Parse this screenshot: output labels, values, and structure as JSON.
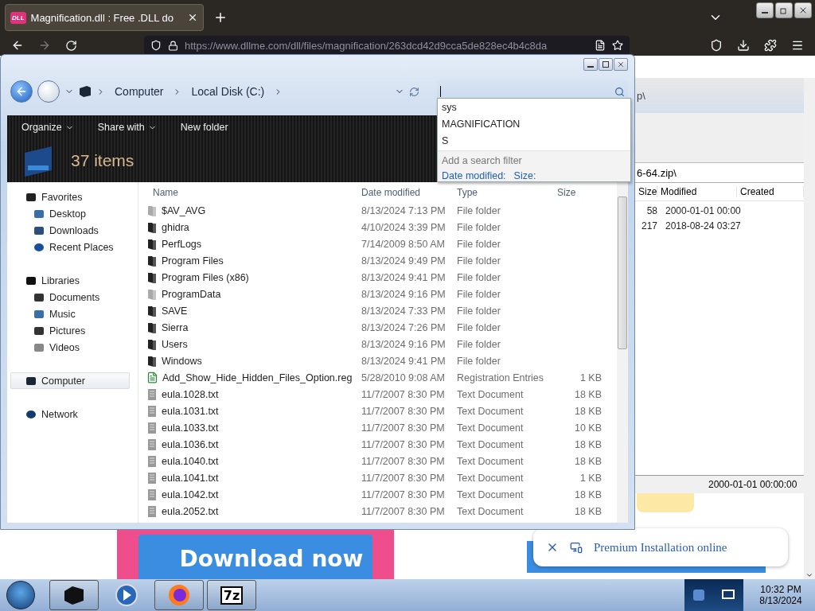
{
  "browser": {
    "tab": {
      "favicon": "DLL",
      "title": "Magnification.dll : Free .DLL do"
    },
    "url": "https://www.dllme.com/dll/files/magnification/263dcd42d9cca5de828ec4b4c8da"
  },
  "background_page": {
    "archive_window": {
      "title_fragment": "p\\",
      "path": "6-64.zip\\",
      "columns": [
        "Size",
        "Modified",
        "Created"
      ],
      "rows": [
        {
          "size": "58",
          "modified": "2000-01-01 00:00"
        },
        {
          "size": "217",
          "modified": "2018-08-24 03:27"
        }
      ],
      "status": "2000-01-01 00:00:00"
    },
    "download_button": "Download now",
    "notice": "Premium Installation online"
  },
  "explorer": {
    "breadcrumb": [
      "Computer",
      "Local Disk (C:)"
    ],
    "toolbar": [
      {
        "label": "Organize",
        "menu": true
      },
      {
        "label": "Share with",
        "menu": true
      },
      {
        "label": "New folder",
        "menu": false
      }
    ],
    "item_count": "37 items",
    "search": {
      "suggestions": [
        "sys",
        "MAGNIFICATION",
        "S"
      ],
      "filter_hint": "Add a search filter",
      "filters": [
        "Date modified:",
        "Size:"
      ]
    },
    "sidebar": [
      {
        "label": "Favorites",
        "kind": "star",
        "selected": false,
        "children": [
          {
            "label": "Desktop",
            "kind": "desktop",
            "selected": false
          },
          {
            "label": "Downloads",
            "kind": "downloads",
            "selected": false
          },
          {
            "label": "Recent Places",
            "kind": "recent",
            "selected": false
          }
        ]
      },
      {
        "label": "Libraries",
        "kind": "library",
        "selected": false,
        "children": [
          {
            "label": "Documents",
            "kind": "documents",
            "selected": false
          },
          {
            "label": "Music",
            "kind": "music",
            "selected": false
          },
          {
            "label": "Pictures",
            "kind": "pictures",
            "selected": false
          },
          {
            "label": "Videos",
            "kind": "videos",
            "selected": false
          }
        ]
      },
      {
        "label": "Computer",
        "kind": "computer",
        "selected": true
      },
      {
        "label": "Network",
        "kind": "network",
        "selected": false
      }
    ],
    "columns": [
      "Name",
      "Date modified",
      "Type",
      "Size"
    ],
    "rows": [
      {
        "kind": "hidden-folder",
        "name": "$AV_AVG",
        "date": "8/13/2024 7:13 PM",
        "type": "File folder"
      },
      {
        "kind": "folder",
        "name": "ghidra",
        "date": "4/10/2024 3:39 PM",
        "type": "File folder"
      },
      {
        "kind": "folder",
        "name": "PerfLogs",
        "date": "7/14/2009 8:50 AM",
        "type": "File folder"
      },
      {
        "kind": "folder",
        "name": "Program Files",
        "date": "8/13/2024 9:49 PM",
        "type": "File folder"
      },
      {
        "kind": "folder",
        "name": "Program Files (x86)",
        "date": "8/13/2024 9:41 PM",
        "type": "File folder"
      },
      {
        "kind": "hidden-folder",
        "name": "ProgramData",
        "date": "8/13/2024 9:16 PM",
        "type": "File folder"
      },
      {
        "kind": "folder",
        "name": "SAVE",
        "date": "8/13/2024 7:33 PM",
        "type": "File folder"
      },
      {
        "kind": "folder",
        "name": "Sierra",
        "date": "8/13/2024 7:26 PM",
        "type": "File folder"
      },
      {
        "kind": "folder",
        "name": "Users",
        "date": "8/13/2024 9:16 PM",
        "type": "File folder"
      },
      {
        "kind": "folder",
        "name": "Windows",
        "date": "8/13/2024 9:41 PM",
        "type": "File folder"
      },
      {
        "kind": "registry",
        "name": "Add_Show_Hide_Hidden_Files_Option.reg",
        "date": "5/28/2010 9:08 AM",
        "type": "Registration Entries",
        "size": "1 KB"
      },
      {
        "kind": "text",
        "name": "eula.1028.txt",
        "date": "11/7/2007 8:30 PM",
        "type": "Text Document",
        "size": "18 KB"
      },
      {
        "kind": "text",
        "name": "eula.1031.txt",
        "date": "11/7/2007 8:30 PM",
        "type": "Text Document",
        "size": "18 KB"
      },
      {
        "kind": "text",
        "name": "eula.1033.txt",
        "date": "11/7/2007 8:30 PM",
        "type": "Text Document",
        "size": "10 KB"
      },
      {
        "kind": "text",
        "name": "eula.1036.txt",
        "date": "11/7/2007 8:30 PM",
        "type": "Text Document",
        "size": "18 KB"
      },
      {
        "kind": "text",
        "name": "eula.1040.txt",
        "date": "11/7/2007 8:30 PM",
        "type": "Text Document",
        "size": "18 KB"
      },
      {
        "kind": "text",
        "name": "eula.1041.txt",
        "date": "11/7/2007 8:30 PM",
        "type": "Text Document",
        "size": "1 KB"
      },
      {
        "kind": "text",
        "name": "eula.1042.txt",
        "date": "11/7/2007 8:30 PM",
        "type": "Text Document",
        "size": "18 KB"
      },
      {
        "kind": "text",
        "name": "eula.2052.txt",
        "date": "11/7/2007 8:30 PM",
        "type": "Text Document",
        "size": "18 KB"
      }
    ]
  },
  "taskbar": {
    "apps": [
      {
        "kind": "explorer",
        "open": true
      },
      {
        "kind": "media",
        "open": false
      },
      {
        "kind": "firefox",
        "open": true
      },
      {
        "kind": "archiver",
        "open": true,
        "label": "7z"
      }
    ],
    "clock": {
      "time": "10:32 PM",
      "date": "8/13/2024"
    }
  }
}
